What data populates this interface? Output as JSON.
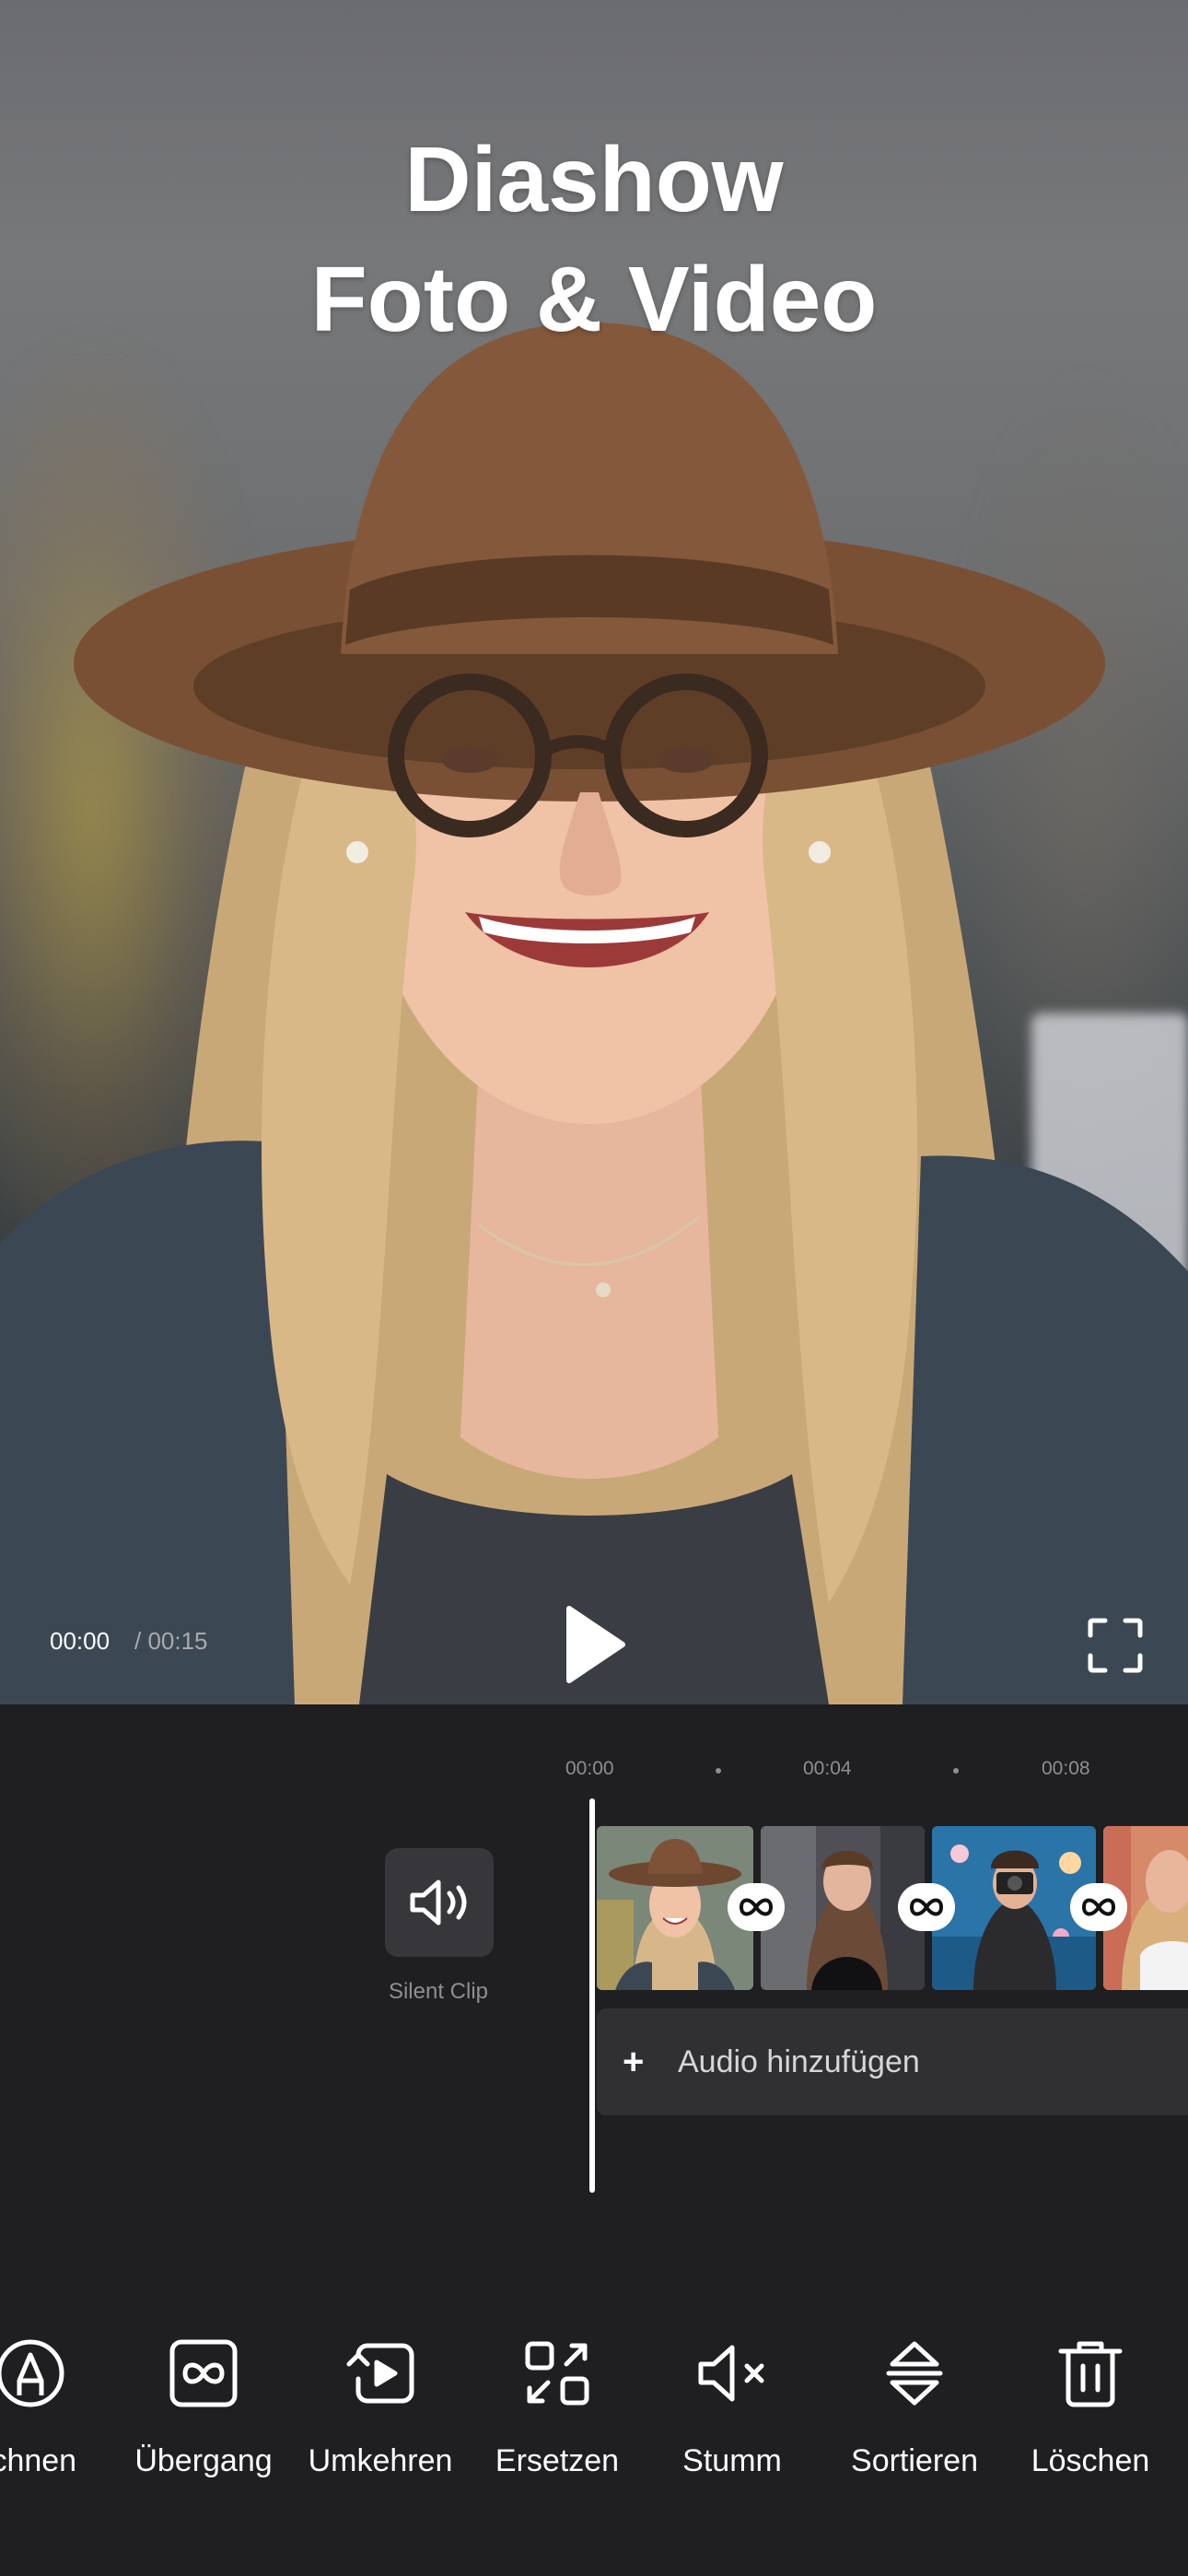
{
  "promo": {
    "headline_line1": "Diashow",
    "headline_line2": "Foto & Video"
  },
  "player": {
    "current_time": "00:00",
    "total_time": "/ 00:15"
  },
  "timeline": {
    "ruler": [
      "00:00",
      "00:04",
      "00:08"
    ],
    "silent_clip_label": "Silent Clip",
    "add_audio_label": "Audio hinzufügen"
  },
  "toolbar": {
    "items": [
      {
        "label": "ichnen",
        "icon": "draw-icon"
      },
      {
        "label": "Übergang",
        "icon": "transition-icon"
      },
      {
        "label": "Umkehren",
        "icon": "reverse-icon"
      },
      {
        "label": "Ersetzen",
        "icon": "replace-icon"
      },
      {
        "label": "Stumm",
        "icon": "mute-icon"
      },
      {
        "label": "Sortieren",
        "icon": "sort-icon"
      },
      {
        "label": "Löschen",
        "icon": "trash-icon"
      }
    ]
  },
  "colors": {
    "background": "#1f1e21",
    "panel": "#303033",
    "accent": "#ffffff",
    "muted_text": "#8e8e93"
  }
}
